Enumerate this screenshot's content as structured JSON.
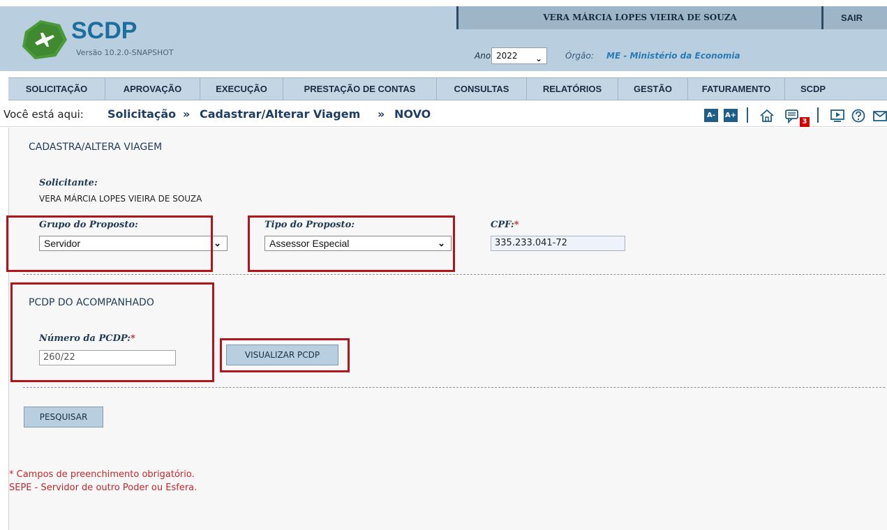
{
  "app": {
    "title": "SCDP",
    "version": "Versão 10.2.0-SNAPSHOT"
  },
  "header": {
    "user_name": "VERA MÁRCIA LOPES VIEIRA DE SOUZA",
    "logout_label": "SAIR",
    "year_label": "Ano:",
    "year_value": "2022",
    "org_label": "Órgão:",
    "org_value": "ME - Ministério da Economia"
  },
  "menu": {
    "items": [
      {
        "label": "SOLICITAÇÃO"
      },
      {
        "label": "APROVAÇÃO"
      },
      {
        "label": "EXECUÇÃO"
      },
      {
        "label": "PRESTAÇÃO DE CONTAS"
      },
      {
        "label": "CONSULTAS"
      },
      {
        "label": "RELATÓRIOS"
      },
      {
        "label": "GESTÃO"
      },
      {
        "label": "FATURAMENTO"
      },
      {
        "label": "SCDP"
      }
    ]
  },
  "breadcrumb": {
    "prefix": "Você está aqui:",
    "items": [
      "Solicitação",
      "Cadastrar/Alterar Viagem",
      "NOVO"
    ],
    "separator": "»"
  },
  "toolbar": {
    "decrease_font": "A-",
    "increase_font": "A+",
    "notification_count": "3"
  },
  "form": {
    "title": "CADASTRA/ALTERA VIAGEM",
    "solicitante_label": "Solicitante:",
    "solicitante_value": "VERA MÁRCIA LOPES VIEIRA DE SOUZA",
    "grupo_label": "Grupo do Proposto:",
    "grupo_value": "Servidor",
    "tipo_label": "Tipo do Proposto:",
    "tipo_value": "Assessor Especial",
    "cpf_label": "CPF:",
    "cpf_value": "335.233.041-72",
    "required_mark": "*"
  },
  "pcdp": {
    "title": "PCDP DO ACOMPANHADO",
    "numero_label": "Número da PCDP:",
    "numero_value": "260/22",
    "visualizar_label": "VISUALIZAR PCDP"
  },
  "search_label": "PESQUISAR",
  "notes": {
    "line1": "* Campos de preenchimento obrigatório.",
    "line2": "SEPE - Servidor de outro Poder ou Esfera."
  },
  "colors": {
    "header_bg": "#b9cfdf",
    "accent": "#1e5d86",
    "highlight": "#b0151b",
    "required": "#c0282d"
  }
}
